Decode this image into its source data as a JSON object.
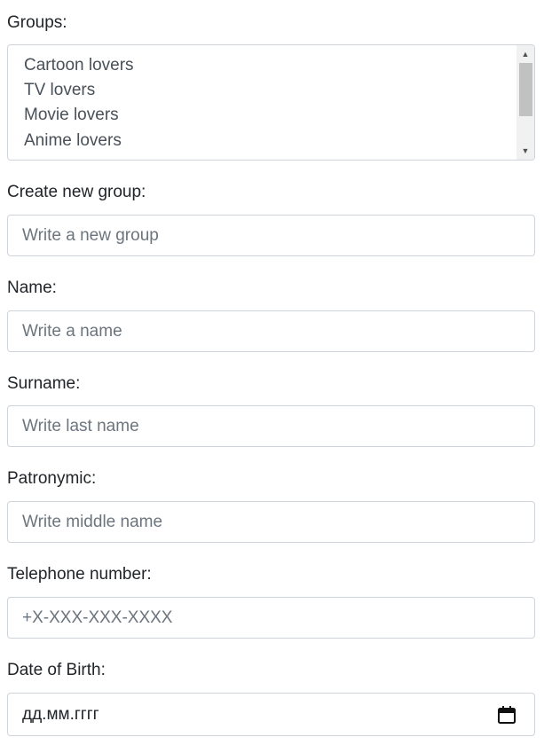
{
  "groups": {
    "label": "Groups:",
    "options": [
      "Cartoon lovers",
      "TV lovers",
      "Movie lovers",
      "Anime lovers"
    ],
    "scroll_up": "▲",
    "scroll_down": "▼"
  },
  "new_group": {
    "label": "Create new group:",
    "placeholder": "Write a new group"
  },
  "name": {
    "label": "Name:",
    "placeholder": "Write a name"
  },
  "surname": {
    "label": "Surname:",
    "placeholder": "Write last name"
  },
  "patronymic": {
    "label": "Patronymic:",
    "placeholder": "Write middle name"
  },
  "telephone": {
    "label": "Telephone number:",
    "placeholder": "+X-XXX-XXX-XXXX"
  },
  "birth": {
    "label": "Date of Birth:",
    "value": "дд.мм.гггг",
    "icon": "calendar-icon"
  },
  "colors": {
    "text": "#212529",
    "border": "#ced4da",
    "placeholder": "#6c757d"
  }
}
